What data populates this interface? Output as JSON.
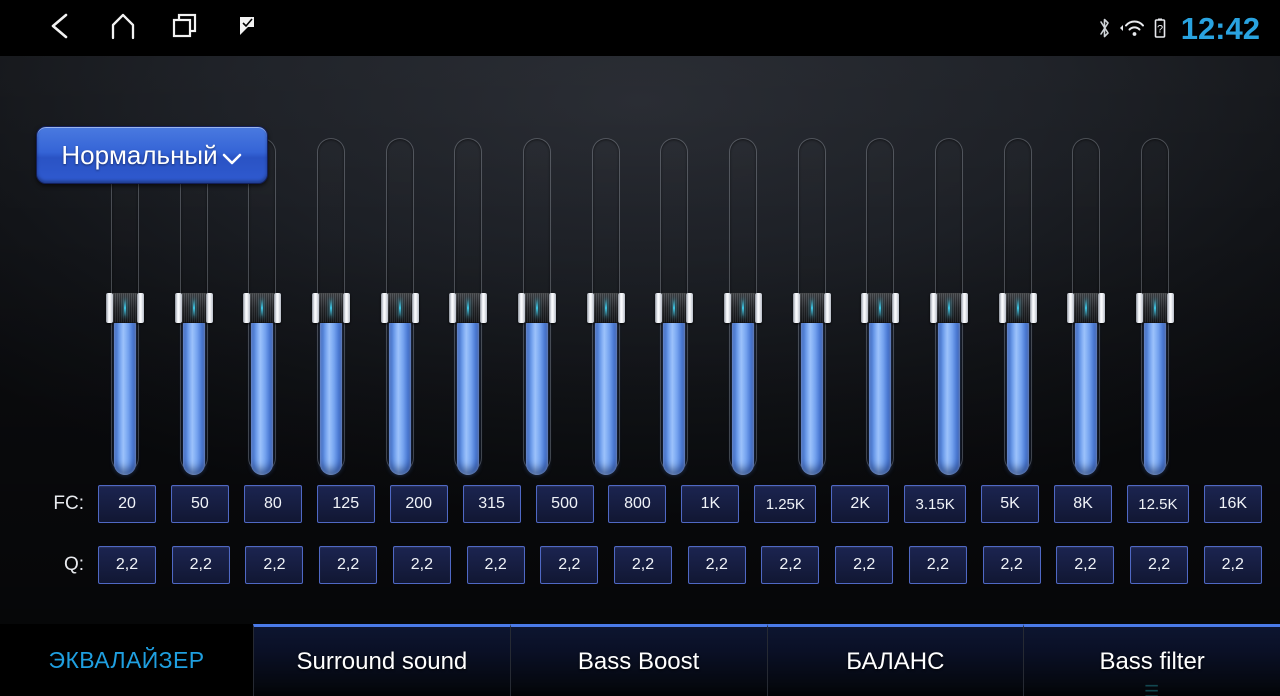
{
  "statusbar": {
    "nav": [
      {
        "name": "back-icon",
        "label": "back"
      },
      {
        "name": "home-icon",
        "label": "home"
      },
      {
        "name": "recents-icon",
        "label": "recents"
      },
      {
        "name": "bookmark-icon",
        "label": "bookmark"
      }
    ],
    "icons": [
      {
        "name": "bluetooth-icon",
        "label": "bluetooth"
      },
      {
        "name": "wifi-icon",
        "label": "wifi"
      },
      {
        "name": "battery-icon",
        "label": "battery-unknown"
      }
    ],
    "time": "12:42"
  },
  "preset": {
    "label": "Нормальный",
    "chevron": "⌄"
  },
  "equalizer": {
    "rows": {
      "fc_label": "FC:",
      "q_label": "Q:"
    },
    "bands": [
      {
        "fc": "20",
        "q": "2,2",
        "level": 49
      },
      {
        "fc": "50",
        "q": "2,2",
        "level": 49
      },
      {
        "fc": "80",
        "q": "2,2",
        "level": 49
      },
      {
        "fc": "125",
        "q": "2,2",
        "level": 49
      },
      {
        "fc": "200",
        "q": "2,2",
        "level": 49
      },
      {
        "fc": "315",
        "q": "2,2",
        "level": 49
      },
      {
        "fc": "500",
        "q": "2,2",
        "level": 49
      },
      {
        "fc": "800",
        "q": "2,2",
        "level": 49
      },
      {
        "fc": "1K",
        "q": "2,2",
        "level": 49
      },
      {
        "fc": "1.25K",
        "q": "2,2",
        "level": 49
      },
      {
        "fc": "2K",
        "q": "2,2",
        "level": 49
      },
      {
        "fc": "3.15K",
        "q": "2,2",
        "level": 49
      },
      {
        "fc": "5K",
        "q": "2,2",
        "level": 49
      },
      {
        "fc": "8K",
        "q": "2,2",
        "level": 49
      },
      {
        "fc": "12.5K",
        "q": "2,2",
        "level": 49
      },
      {
        "fc": "16K",
        "q": "2,2",
        "level": 49
      }
    ]
  },
  "tabs": [
    {
      "label": "ЭКВАЛАЙЗЕР",
      "active": true
    },
    {
      "label": "Surround sound",
      "active": false
    },
    {
      "label": "Bass Boost",
      "active": false
    },
    {
      "label": "БАЛАНС",
      "active": false
    },
    {
      "label": "Bass filter",
      "active": false
    }
  ],
  "colors": {
    "accent_blue": "#1f9fe0",
    "clock_blue": "#29a3e0",
    "slider_blue": "#9cc2fb",
    "cell_border": "#4f68c4",
    "tab_top_border": "#4a7ae8"
  }
}
